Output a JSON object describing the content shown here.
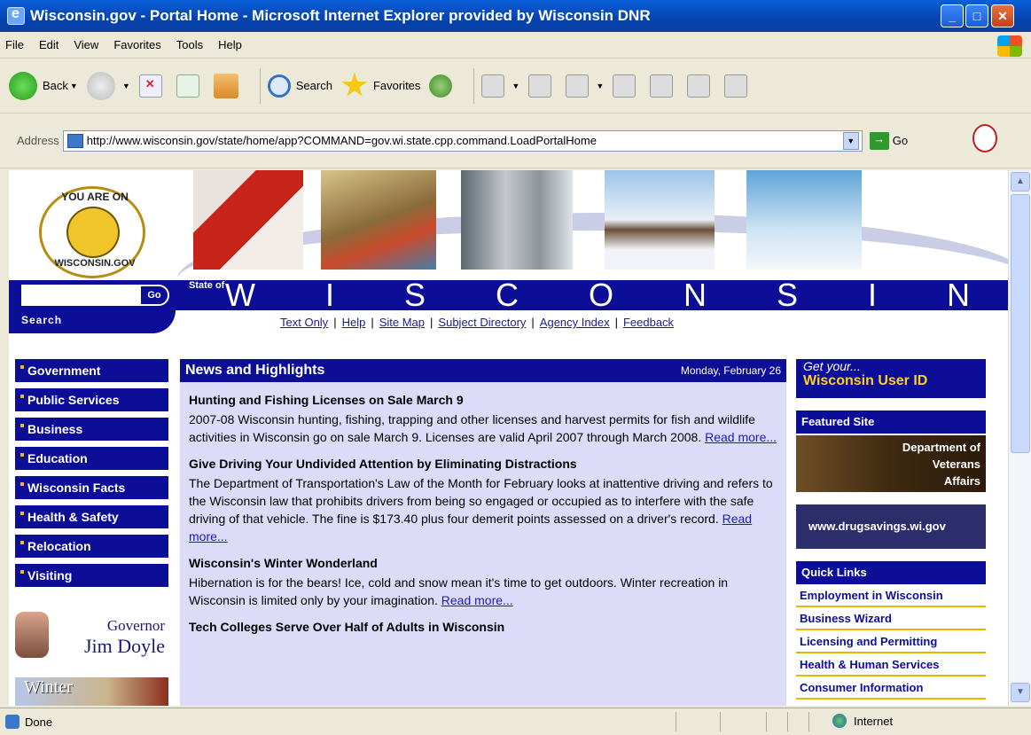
{
  "window": {
    "title": "Wisconsin.gov - Portal Home - Microsoft Internet Explorer provided by Wisconsin DNR",
    "minimize": "_",
    "maximize": "□",
    "close": "✕"
  },
  "menu": [
    "File",
    "Edit",
    "View",
    "Favorites",
    "Tools",
    "Help"
  ],
  "toolbar": {
    "back": "Back",
    "search": "Search",
    "favorites": "Favorites"
  },
  "address": {
    "label": "Address",
    "url": "http://www.wisconsin.gov/state/home/app?COMMAND=gov.wi.state.cpp.command.LoadPortalHome",
    "go": "Go"
  },
  "site": {
    "seal_top": "YOU ARE ON",
    "seal_bottom": "WISCONSIN.GOV",
    "search_go": "Go",
    "search_label": "Search",
    "state_of": "State of",
    "wordmark": [
      "W",
      "I",
      "S",
      "C",
      "O",
      "N",
      "S",
      "I",
      "N"
    ],
    "top_links": [
      "Text Only",
      "Help",
      "Site Map",
      "Subject Directory",
      "Agency Index",
      "Feedback"
    ]
  },
  "nav": [
    "Government",
    "Public Services",
    "Business",
    "Education",
    "Wisconsin Facts",
    "Health & Safety",
    "Relocation",
    "Visiting"
  ],
  "governor": {
    "line1": "Governor",
    "line2": "Jim Doyle"
  },
  "winter_promo": "Winter",
  "news": {
    "title": "News and Highlights",
    "date": "Monday, February 26",
    "read_more": "Read more...",
    "articles": [
      {
        "headline": "Hunting and Fishing Licenses on Sale March 9",
        "body": "2007-08 Wisconsin hunting, fishing, trapping and other licenses and harvest permits for fish and wildlife activities in Wisconsin go on sale March 9. Licenses are valid April 2007 through March 2008."
      },
      {
        "headline": "Give Driving Your Undivided Attention by Eliminating Distractions",
        "body": "The Department of Transportation's Law of the Month for February looks at inattentive driving and refers to the Wisconsin law that prohibits drivers from being so engaged or occupied as to interfere with the safe driving of that vehicle. The fine is $173.40 plus four demerit points assessed on a driver's record."
      },
      {
        "headline": "Wisconsin's Winter Wonderland",
        "body": "Hibernation is for the bears! Ice, cold and snow mean it's time to get outdoors. Winter recreation in Wisconsin is limited only by your imagination."
      },
      {
        "headline": "Tech Colleges Serve Over Half of Adults in Wisconsin",
        "body": ""
      }
    ]
  },
  "right": {
    "userid_line1": "Get your...",
    "userid_line2": "Wisconsin User ID",
    "featured_title": "Featured Site",
    "featured_l1": "Department of",
    "featured_l2": "Veterans",
    "featured_l3": "Affairs",
    "drugsavings": "www.drugsavings.wi.gov",
    "quick_links_title": "Quick Links",
    "quick_links": [
      "Employment in Wisconsin",
      "Business Wizard",
      "Licensing and Permitting",
      "Health & Human Services",
      "Consumer Information"
    ]
  },
  "status": {
    "text": "Done",
    "zone": "Internet"
  }
}
